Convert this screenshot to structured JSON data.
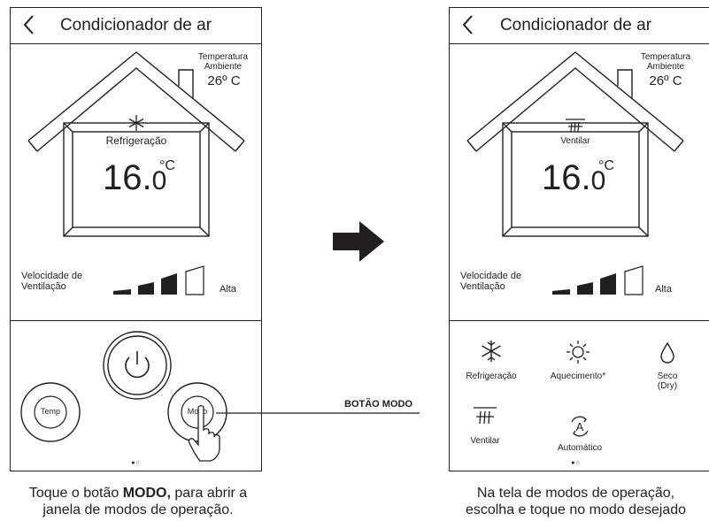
{
  "left": {
    "header": {
      "title": "Condicionador de ar"
    },
    "ambient": {
      "label_line1": "Temperatura",
      "label_line2": "Ambiente",
      "value": "26º C"
    },
    "mode_label": "Refrigeração",
    "temp": {
      "whole": "16.",
      "decimal": "0",
      "unit": "°C"
    },
    "fan": {
      "label_line1": "Velocidade de",
      "label_line2": "Ventilação",
      "level": "Alta"
    },
    "buttons": {
      "temp": "Temp",
      "mode": "Modo"
    },
    "pager": "●○",
    "caption_pre": "Toque o botão ",
    "caption_bold": "MODO,",
    "caption_post": " para abrir a",
    "caption_line2": "janela de modos de operação."
  },
  "callout": "BOTÃO MODO",
  "right": {
    "header": {
      "title": "Condicionador de ar"
    },
    "ambient": {
      "label_line1": "Temperatura",
      "label_line2": "Ambiente",
      "value": "26º C"
    },
    "mode_label": "Ventilar",
    "temp": {
      "whole": "16.",
      "decimal": "0",
      "unit": "°C"
    },
    "fan": {
      "label_line1": "Velocidade de",
      "label_line2": "Ventilação",
      "level": "Alta"
    },
    "modes": {
      "cool": "Refrigeração",
      "heat": "Aquecimento*",
      "dry_line1": "Seco",
      "dry_line2": "(Dry)",
      "fan": "Ventilar",
      "auto": "Automático"
    },
    "pager": "●○",
    "caption_line1": "Na tela de modos de operação,",
    "caption_line2": "escolha e toque no modo desejado"
  },
  "colors": {
    "ink": "#231f20"
  }
}
